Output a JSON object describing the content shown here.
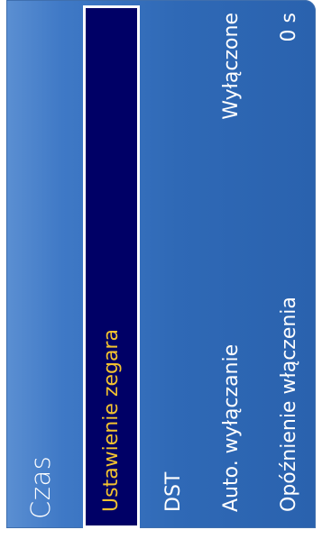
{
  "panel": {
    "title": "Czas"
  },
  "menu": {
    "items": [
      {
        "label": "Ustawienie zegara",
        "value": "",
        "selected": true
      },
      {
        "label": "DST",
        "value": "",
        "selected": false
      },
      {
        "label": "Auto. wyłączanie",
        "value": "Wyłączone",
        "selected": false
      },
      {
        "label": "Opóźnienie włączenia",
        "value": "0 s",
        "selected": false
      }
    ]
  },
  "colors": {
    "panel_background": "#2f69b6",
    "selected_background": "#000066",
    "selected_text": "#f2c230",
    "text": "#ffffff"
  }
}
